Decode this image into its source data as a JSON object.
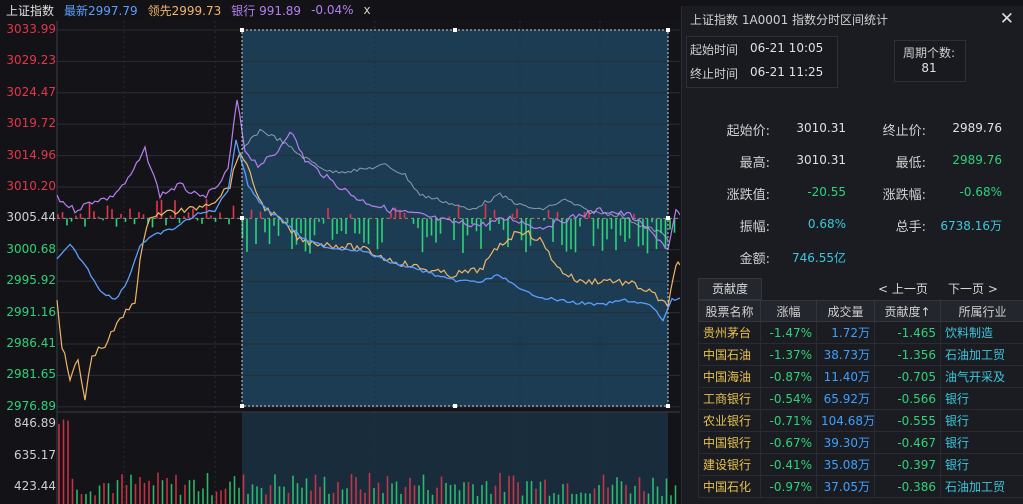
{
  "header": {
    "index_name": "上证指数",
    "latest": "最新2997.79",
    "leading": "领先2999.73",
    "bank": "银行 991.89",
    "change": "-0.04%",
    "close_symbol": "x"
  },
  "chart": {
    "price_ticks": [
      "3033.99",
      "3029.23",
      "3024.47",
      "3019.72",
      "3014.96",
      "3010.20",
      "3005.44",
      "3000.68",
      "2995.92",
      "2991.16",
      "2986.41",
      "2981.65",
      "2976.89"
    ],
    "volume_ticks": [
      "846.89",
      "635.17",
      "423.44"
    ],
    "colors": {
      "latest": "#5b9eff",
      "leading": "#f0b56a",
      "bank": "#b57ff0",
      "up": "#e3364c",
      "down": "#2fd27a",
      "axis_up": "#e3364c",
      "axis_down": "#2fd27a",
      "axis_ref": "#d0d0d0",
      "selection": "#1e4a66"
    }
  },
  "panel": {
    "title": "上证指数  1A0001  指数分时区间统计",
    "start_label": "起始时间",
    "start_time": "06-21 10:05",
    "end_label": "终止时间",
    "end_time": "06-21 11:25",
    "period_label": "周期个数:",
    "period_count": "81",
    "stats": {
      "start_price_label": "起始价:",
      "start_price": "3010.31",
      "end_price_label": "终止价:",
      "end_price": "2989.76",
      "high_label": "最高:",
      "high": "3010.31",
      "low_label": "最低:",
      "low": "2989.76",
      "change_value_label": "涨跌值:",
      "change_value": "-20.55",
      "change_pct_label": "涨跌幅:",
      "change_pct": "-0.68%",
      "amplitude_label": "振幅:",
      "amplitude": "0.68%",
      "volume_label": "总手:",
      "volume": "6738.16万",
      "amount_label": "金额:",
      "amount": "746.55亿"
    },
    "contribution_tab": "贡献度",
    "prev_page": "< 上一页",
    "next_page": "下一页 >",
    "columns": [
      "股票名称",
      "涨幅",
      "成交量",
      "贡献度↑",
      "所属行业"
    ],
    "rows": [
      [
        "贵州茅台",
        "-1.47%",
        "1.72万",
        "-1.465",
        "饮料制造"
      ],
      [
        "中国石油",
        "-1.37%",
        "38.73万",
        "-1.356",
        "石油加工贸"
      ],
      [
        "中国海油",
        "-0.87%",
        "11.40万",
        "-0.705",
        "油气开采及"
      ],
      [
        "工商银行",
        "-0.54%",
        "65.92万",
        "-0.566",
        "银行"
      ],
      [
        "农业银行",
        "-0.71%",
        "104.68万",
        "-0.555",
        "银行"
      ],
      [
        "中国银行",
        "-0.67%",
        "39.30万",
        "-0.467",
        "银行"
      ],
      [
        "建设银行",
        "-0.41%",
        "35.08万",
        "-0.397",
        "银行"
      ],
      [
        "中国石化",
        "-0.97%",
        "37.05万",
        "-0.386",
        "石油加工贸"
      ]
    ]
  }
}
